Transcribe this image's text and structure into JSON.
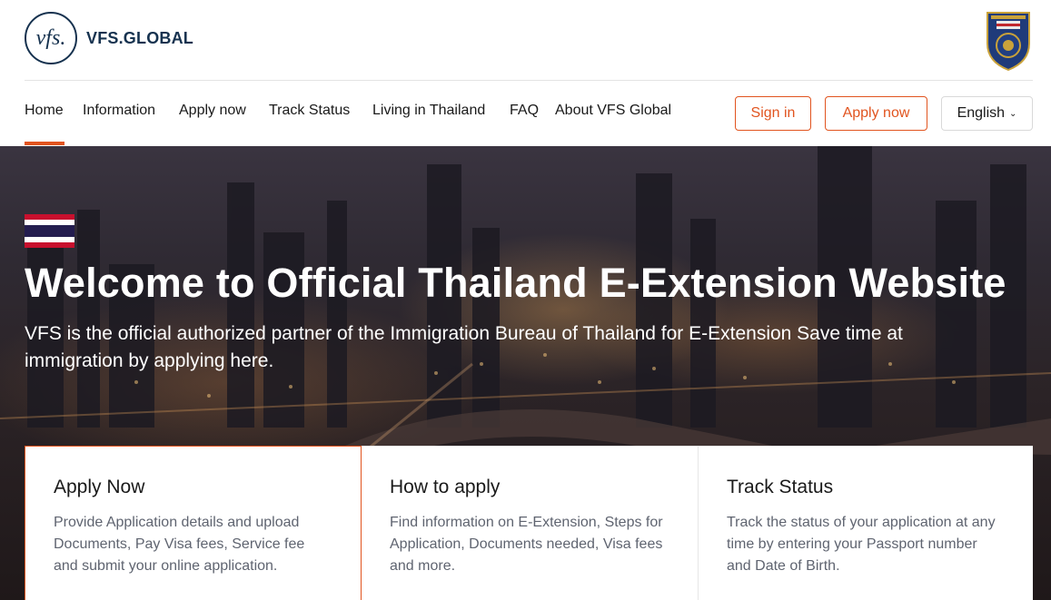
{
  "header": {
    "logo_mark": "vfs.",
    "logo_text": "VFS.GLOBAL",
    "emblem_icon": "royal-thai-police-emblem"
  },
  "nav": {
    "items": [
      {
        "label": "Home",
        "active": true
      },
      {
        "label": "Information"
      },
      {
        "label": "Apply now"
      },
      {
        "label": "Track Status"
      },
      {
        "label": "Living in Thailand"
      },
      {
        "label": "FAQ"
      },
      {
        "label": "About VFS Global"
      }
    ],
    "sign_in_label": "Sign in",
    "apply_now_label": "Apply now",
    "language_label": "English",
    "accent_color": "#e1541f"
  },
  "hero": {
    "flag_icon": "thailand-flag",
    "title": "Welcome to Official Thailand E-Extension Website",
    "subtitle": "VFS is the official authorized partner of the Immigration Bureau of Thailand for E-Extension Save time at immigration by applying here."
  },
  "cards": [
    {
      "title": "Apply Now",
      "text": "Provide Application details and upload Documents, Pay Visa fees, Service fee and submit your online application."
    },
    {
      "title": "How to apply",
      "text": "Find information on E-Extension, Steps for Application, Documents needed, Visa fees and more."
    },
    {
      "title": "Track Status",
      "text": "Track the status of your application at any time by entering your Passport number and Date of Birth."
    }
  ]
}
